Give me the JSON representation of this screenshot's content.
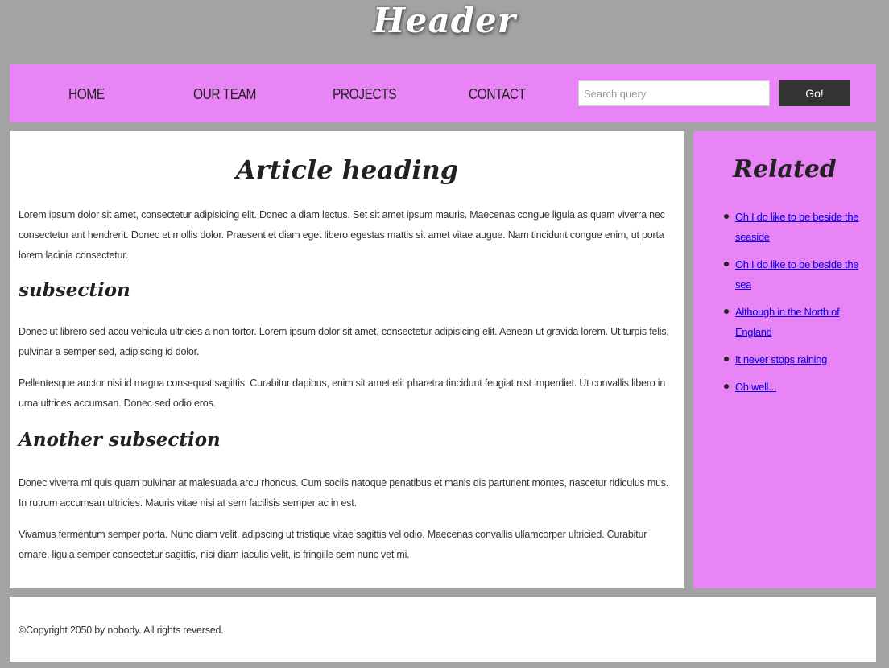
{
  "header": {
    "title": "Header"
  },
  "nav": {
    "items": [
      {
        "label": "HOME"
      },
      {
        "label": "OUR TEAM"
      },
      {
        "label": "PROJECTS"
      },
      {
        "label": "CONTACT"
      }
    ],
    "search": {
      "placeholder": "Search query",
      "value": "",
      "button_label": "Go!"
    }
  },
  "article": {
    "heading": "Article heading",
    "paragraphs": [
      "Lorem ipsum dolor sit amet, consectetur adipisicing elit. Donec a diam lectus. Set sit amet ipsum mauris. Maecenas congue ligula as quam viverra nec consectetur ant hendrerit. Donec et mollis dolor. Praesent et diam eget libero egestas mattis sit amet vitae augue. Nam tincidunt congue enim, ut porta lorem lacinia consectetur.",
      "Donec ut librero sed accu vehicula ultricies a non tortor. Lorem ipsum dolor sit amet, consectetur adipisicing elit. Aenean ut gravida lorem. Ut turpis felis, pulvinar a semper sed, adipiscing id dolor.",
      "Pellentesque auctor nisi id magna consequat sagittis. Curabitur dapibus, enim sit amet elit pharetra tincidunt feugiat nist imperdiet. Ut convallis libero in urna ultrices accumsan. Donec sed odio eros.",
      "Donec viverra mi quis quam pulvinar at malesuada arcu rhoncus. Cum sociis natoque penatibus et manis dis parturient montes, nascetur ridiculus mus. In rutrum accumsan ultricies. Mauris vitae nisi at sem facilisis semper ac in est.",
      "Vivamus fermentum semper porta. Nunc diam velit, adipscing ut tristique vitae sagittis vel odio. Maecenas convallis ullamcorper ultricied. Curabitur ornare, ligula semper consectetur sagittis, nisi diam iaculis velit, is fringille sem nunc vet mi."
    ],
    "subsections": [
      "subsection",
      "Another subsection"
    ]
  },
  "related": {
    "heading": "Related",
    "links": [
      "Oh I do like to be beside the seaside",
      "Oh I do like to be beside the sea",
      "Although in the North of England",
      "It never stops raining",
      "Oh well..."
    ]
  },
  "footer": {
    "copyright": "©Copyright 2050 by nobody. All rights reversed."
  },
  "colors": {
    "page_background": "#a3a3a3",
    "nav_background": "#e884f5",
    "content_background": "#ffffff",
    "button_background": "#333333",
    "link": "#0000ee"
  }
}
